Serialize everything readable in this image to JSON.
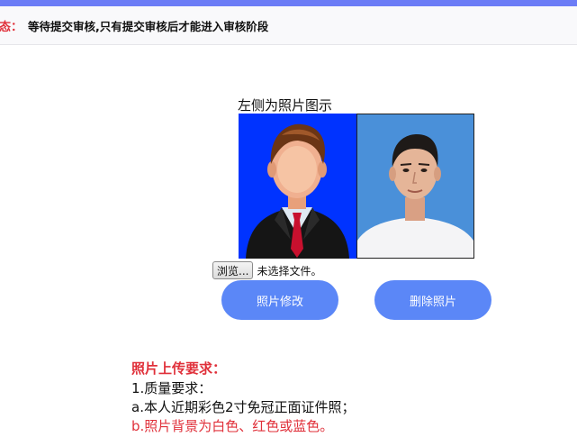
{
  "header": {
    "status_label": "状态：",
    "status_text": "等待提交审核,只有提交审核后才能进入审核阶段"
  },
  "photo_section": {
    "caption": "左侧为照片图示",
    "sample_photo_bg": "#0033ff",
    "user_photo_bg": "#4a90d9"
  },
  "file_input": {
    "browse_label": "浏览...",
    "status": "未选择文件。"
  },
  "actions": {
    "modify_label": "照片修改",
    "delete_label": "删除照片",
    "accent_color": "#5b87f7"
  },
  "requirements": {
    "title": "照片上传要求：",
    "line1": "1.质量要求：",
    "line2": "a.本人近期彩色2寸免冠正面证件照；",
    "line3": "b.照片背景为白色、红色或蓝色。"
  }
}
